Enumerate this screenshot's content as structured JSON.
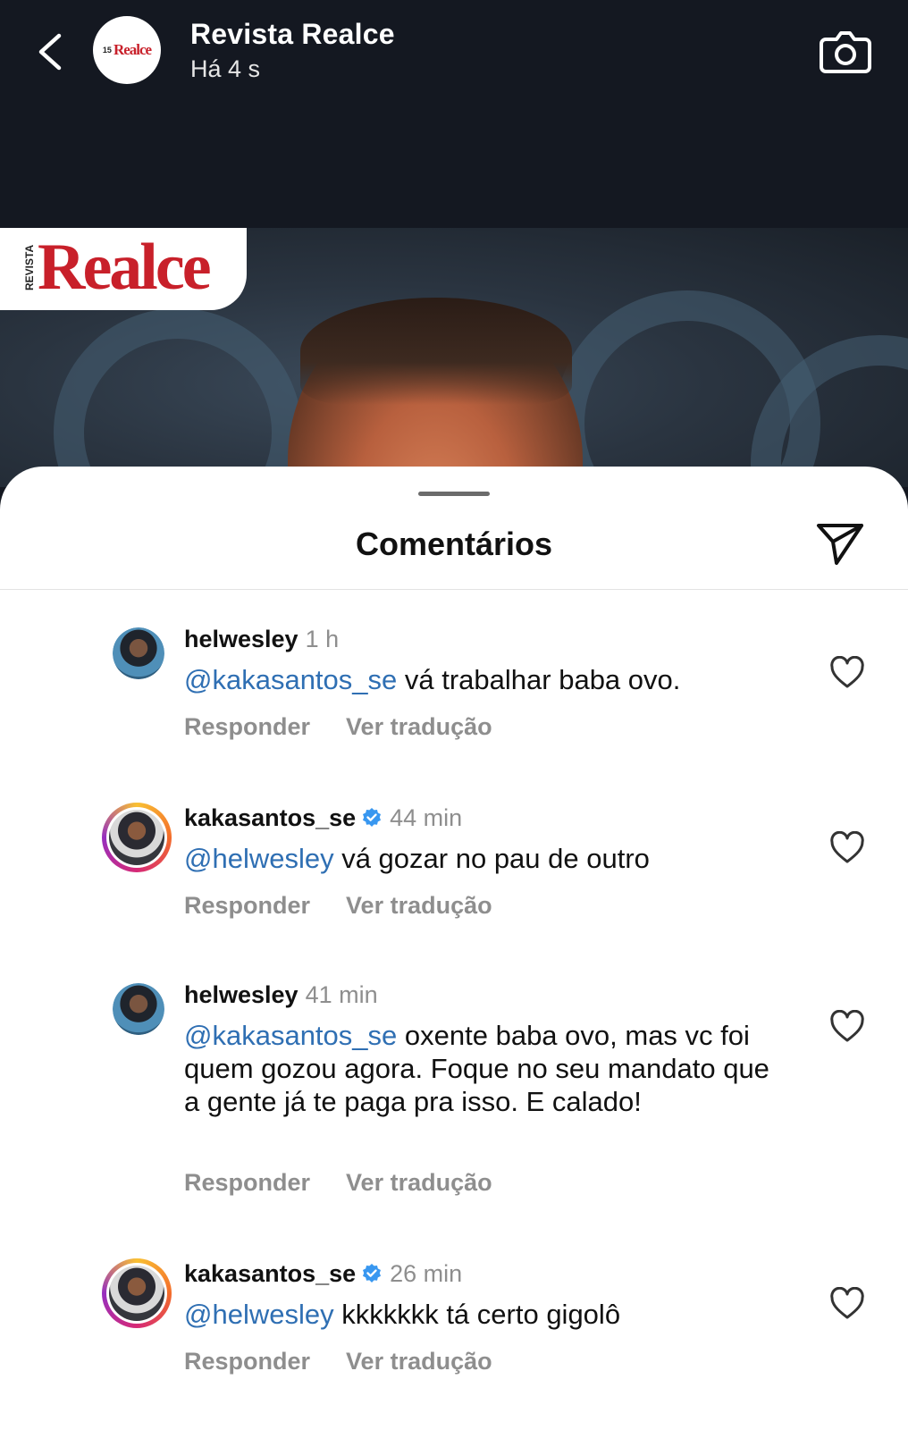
{
  "header": {
    "title": "Revista Realce",
    "time": "Há 4 s",
    "avatar_logo_text": "Realce",
    "avatar_logo_num": "15"
  },
  "story_image": {
    "brand_small": "REVISTA",
    "brand_name": "Realce"
  },
  "sheet": {
    "title": "Comentários"
  },
  "comments": [
    {
      "user": "helwesley",
      "time": "1 h",
      "verified": false,
      "mention": "@kakasantos_se",
      "text": " vá trabalhar baba ovo.",
      "reply_label": "Responder",
      "translate_label": "Ver tradução"
    },
    {
      "user": "kakasantos_se",
      "time": "44 min",
      "verified": true,
      "mention": "@helwesley",
      "text": " vá gozar no pau de outro",
      "reply_label": "Responder",
      "translate_label": "Ver tradução"
    },
    {
      "user": "helwesley",
      "time": "41 min",
      "verified": false,
      "mention": "@kakasantos_se",
      "text": " oxente baba ovo, mas vc foi quem gozou agora. Foque no seu mandato que a gente já te paga pra isso. E calado!",
      "reply_label": "Responder",
      "translate_label": "Ver tradução"
    },
    {
      "user": "kakasantos_se",
      "time": "26 min",
      "verified": true,
      "mention": "@helwesley",
      "text": " kkkkkkk tá certo gigolô",
      "reply_label": "Responder",
      "translate_label": "Ver tradução"
    }
  ],
  "colors": {
    "mention": "#2f6fb3",
    "verified": "#3897f0",
    "muted": "#8e8e8e",
    "brand_red": "#c8202a"
  },
  "icons": {
    "back": "chevron-left-icon",
    "camera": "camera-icon",
    "send": "send-icon",
    "like": "heart-icon",
    "verified": "verified-badge-icon"
  }
}
